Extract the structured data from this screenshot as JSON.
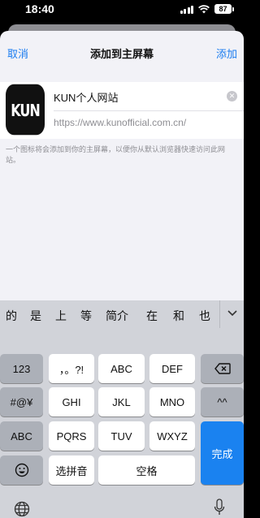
{
  "status_bar": {
    "time": "18:40",
    "battery": "87"
  },
  "nav": {
    "cancel": "取消",
    "title": "添加到主屏幕",
    "add": "添加"
  },
  "bookmark": {
    "icon_text": "KUN",
    "name": "KUN个人网站",
    "url": "https://www.kunofficial.com.cn/"
  },
  "description": "一个图标将会添加到你的主屏幕，以便你从默认浏览器快速访问此网站。",
  "keyboard": {
    "candidates": [
      "的",
      "是",
      "上",
      "等",
      "简介",
      "在",
      "和",
      "也"
    ],
    "keys": {
      "num": "123",
      "punct": "，。?!",
      "abc_1": "ABC",
      "def": "DEF",
      "sym": "#@¥",
      "ghi": "GHI",
      "jkl": "JKL",
      "mno": "MNO",
      "caps": "^^",
      "abc_2": "ABC",
      "pqrs": "PQRS",
      "tuv": "TUV",
      "wxyz": "WXYZ",
      "done": "完成",
      "pinyin": "选拼音",
      "space": "空格"
    }
  },
  "colors": {
    "accent": "#1a7cf0",
    "done_key": "#1a82f0",
    "keyboard_bg": "#d1d3d9"
  }
}
